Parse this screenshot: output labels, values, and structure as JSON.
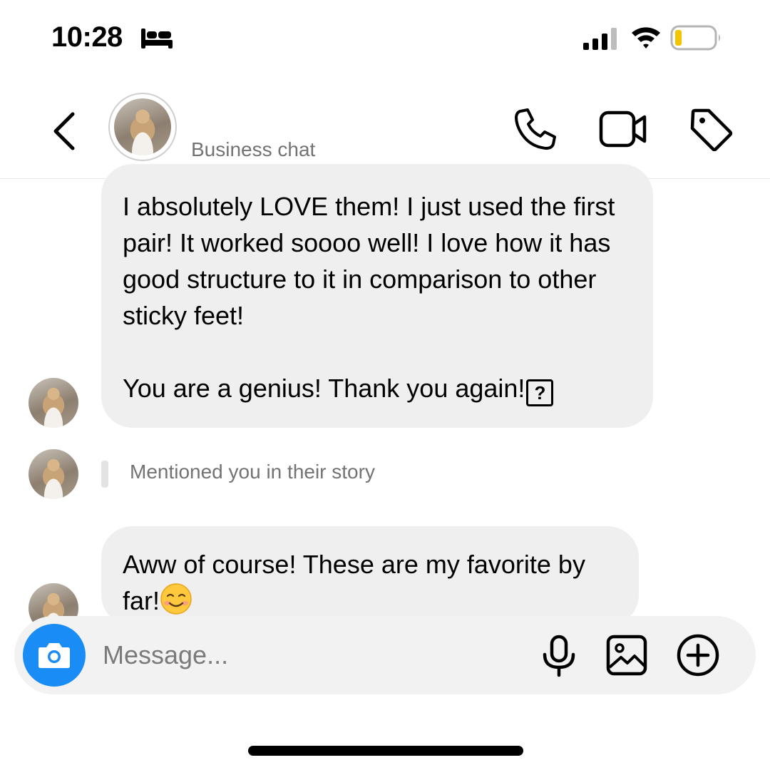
{
  "status_bar": {
    "time": "10:28",
    "icons": [
      "bed-icon",
      "signal-icon",
      "wifi-icon",
      "battery-icon"
    ],
    "battery_color": "#f5c400"
  },
  "header": {
    "subtitle": "Business chat",
    "icons": [
      "back-chevron-icon",
      "avatar",
      "phone-icon",
      "video-camera-icon",
      "tag-icon"
    ]
  },
  "messages": [
    {
      "paragraph1": "I absolutely LOVE them! I just used the first pair! It worked soooo well! I love how it has good structure to it in comparison to other sticky feet!",
      "paragraph2": "You are a genius! Thank you again!",
      "trailing_glyph": "?"
    },
    {
      "story_note": "Mentioned you in their story"
    },
    {
      "text": "Aww of course! These are my favorite by far!",
      "emoji": "smiling-face-icon"
    }
  ],
  "composer": {
    "placeholder": "Message...",
    "icons": [
      "camera-icon",
      "microphone-icon",
      "image-icon",
      "plus-circle-icon"
    ],
    "camera_color": "#1a8cf5"
  },
  "colors": {
    "bubble": "#efefef",
    "secondary_text": "#737373"
  }
}
